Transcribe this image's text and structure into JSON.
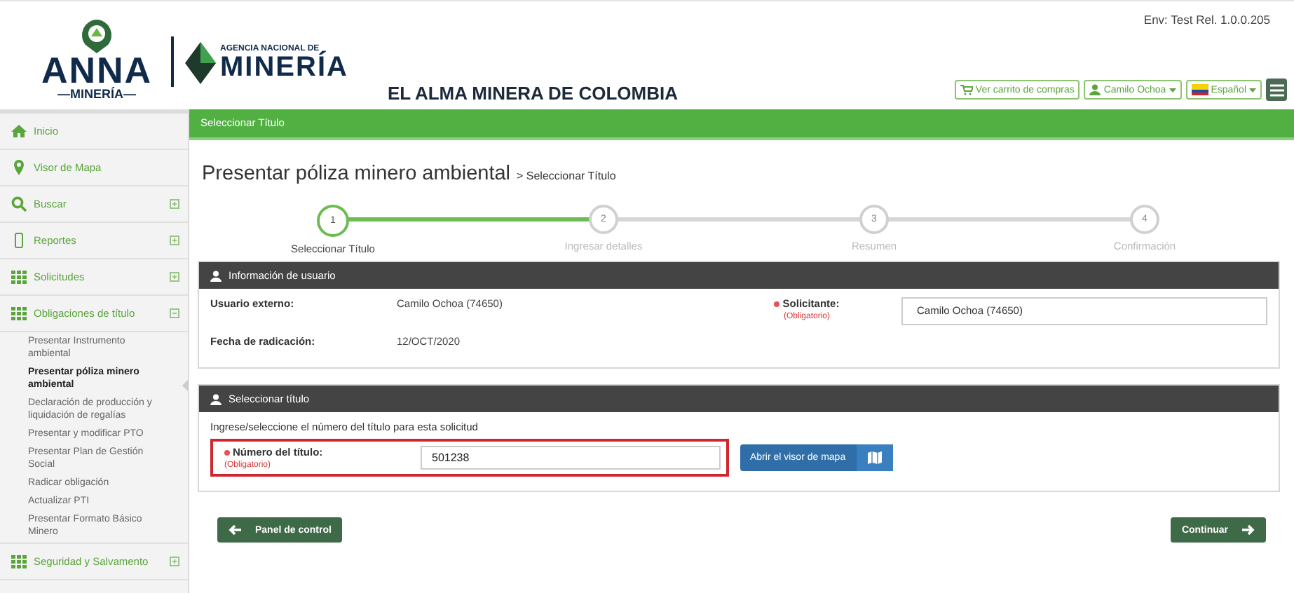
{
  "header": {
    "logo_word": "ANNA",
    "logo_sub": "—MINERÍA—",
    "agency_small": "AGENCIA NACIONAL DE",
    "agency_big": "MINERÍA",
    "slogan": "EL ALMA MINERA DE COLOMBIA",
    "env": "Env: Test Rel. 1.0.0.205",
    "buttons": [
      {
        "kind": "cart",
        "label": "Ver carrito de compras"
      },
      {
        "kind": "user",
        "label": "Camilo Ochoa"
      },
      {
        "kind": "lang",
        "label": "Español"
      }
    ]
  },
  "sidebar": {
    "items": [
      {
        "kind": "home",
        "label": "Inicio"
      },
      {
        "kind": "pin",
        "label": "Visor de Mapa"
      },
      {
        "kind": "search",
        "label": "Buscar",
        "expanded": false
      },
      {
        "kind": "mobile",
        "label": "Reportes",
        "expanded": false
      },
      {
        "kind": "grid",
        "label": "Solicitudes",
        "expanded": false
      },
      {
        "kind": "grid",
        "label": "Obligaciones de título",
        "expanded": true,
        "children": [
          {
            "label": "Presentar Instrumento ambiental",
            "selected": false
          },
          {
            "label": "Presentar póliza minero ambiental",
            "selected": true
          },
          {
            "label": "Declaración de producción y liquidación de regalías",
            "selected": false
          },
          {
            "label": "Presentar y modificar PTO",
            "selected": false
          },
          {
            "label": "Presentar Plan de Gestión Social",
            "selected": false
          },
          {
            "label": "Radicar obligación",
            "selected": false
          },
          {
            "label": "Actualizar PTI",
            "selected": false
          },
          {
            "label": "Presentar Formato Básico Minero",
            "selected": false
          }
        ]
      },
      {
        "kind": "grid",
        "label": "Seguridad y Salvamento",
        "expanded": false
      }
    ]
  },
  "page_bar": "Seleccionar Título",
  "title": "Presentar póliza minero ambiental",
  "breadcrumb": "> Seleccionar Título",
  "steps": [
    {
      "number": "1",
      "label": "Seleccionar Título",
      "selected": true
    },
    {
      "number": "2",
      "label": "Ingresar detalles",
      "selected": false
    },
    {
      "number": "3",
      "label": "Resumen",
      "selected": false
    },
    {
      "number": "4",
      "label": "Confirmación",
      "selected": false
    }
  ],
  "user_panel": {
    "title": "Información de usuario",
    "user_label": "Usuario externo:",
    "user_value": "Camilo Ochoa (74650)",
    "date_label": "Fecha de radicación:",
    "date_value": "12/OCT/2020",
    "applicant_label": "Solicitante:",
    "applicant_required": "(Obligatorio)",
    "applicant_value": "Camilo  Ochoa  (74650)"
  },
  "title_panel": {
    "title": "Seleccionar título",
    "instruction": "Ingrese/seleccione el número del título para esta solicitud",
    "number_label": "Número del título:",
    "number_required": "(Obligatorio)",
    "number_value": "501238",
    "map_button": "Abrir el visor de mapa"
  },
  "back_button": "Panel de control",
  "next_button": "Continuar"
}
